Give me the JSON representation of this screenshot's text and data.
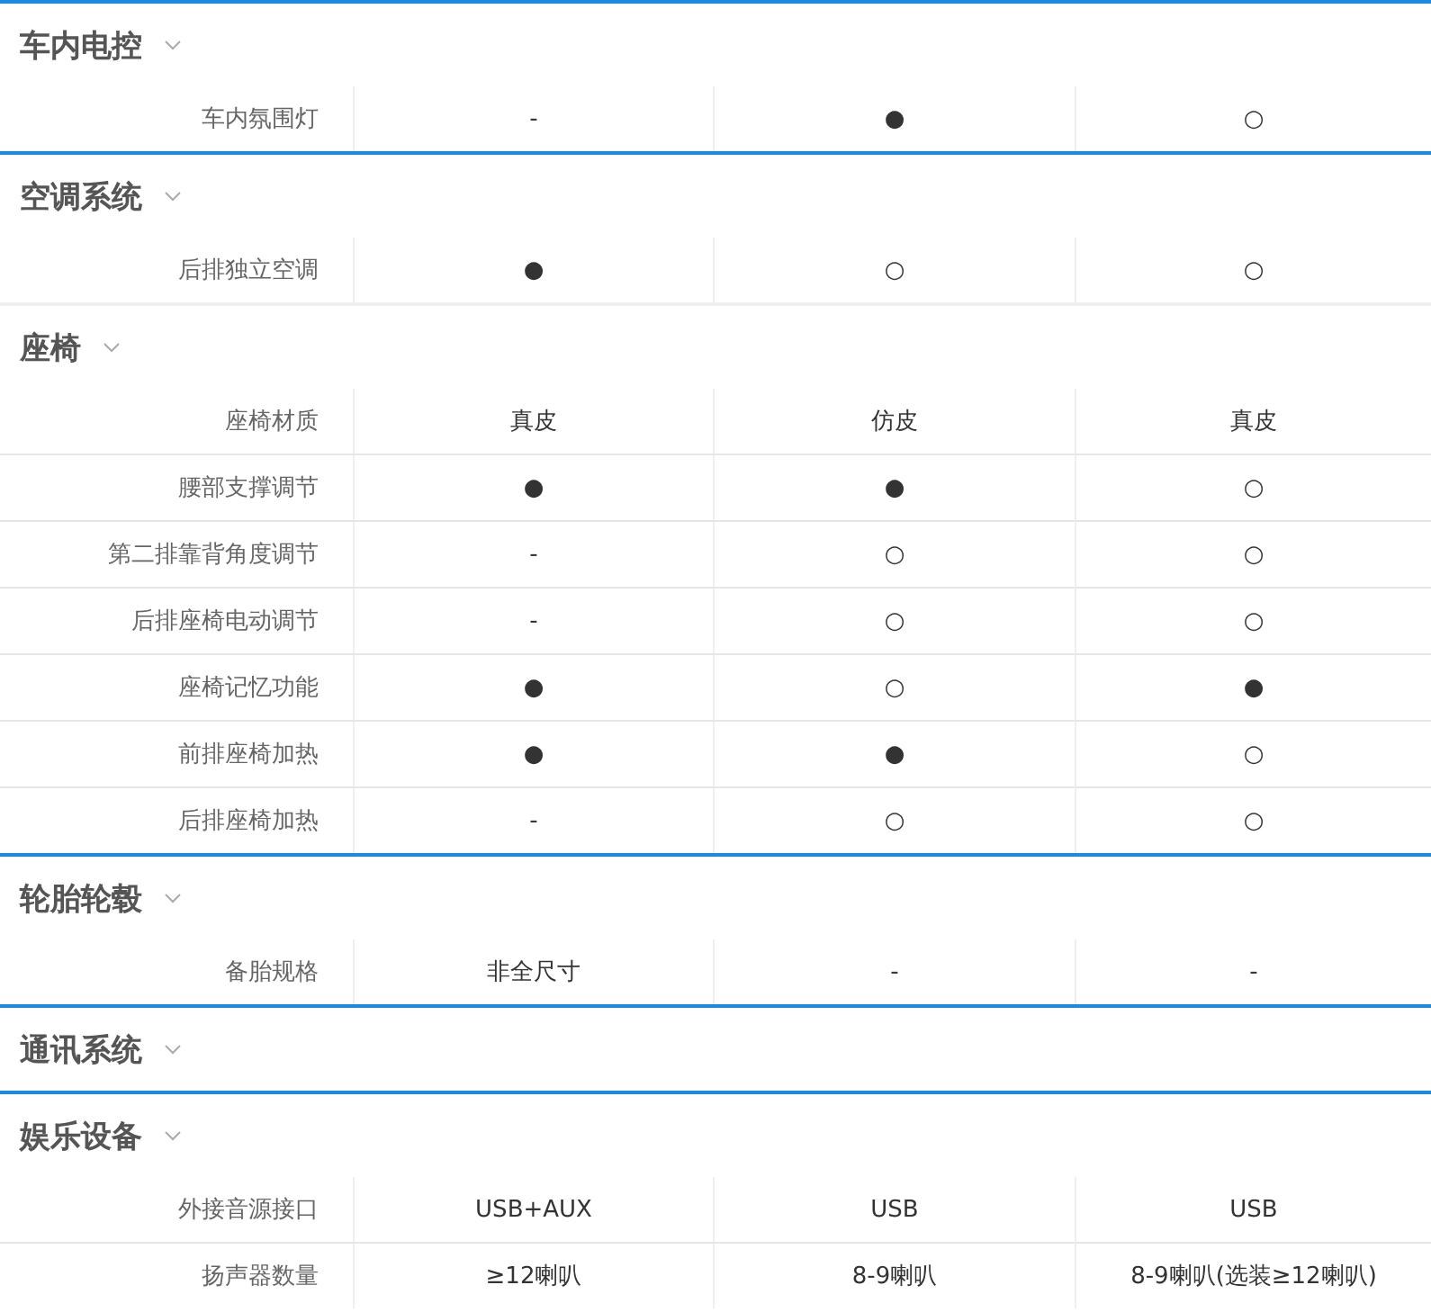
{
  "sections": [
    {
      "title": "车内电控",
      "accent_line": true,
      "rows": [
        {
          "label": "车内氛围灯",
          "values": [
            "-",
            "●",
            "○"
          ]
        }
      ]
    },
    {
      "title": "空调系统",
      "accent_line": true,
      "rows": [
        {
          "label": "后排独立空调",
          "values": [
            "●",
            "○",
            "○"
          ]
        }
      ]
    },
    {
      "title": "座椅",
      "accent_line": false,
      "rows": [
        {
          "label": "座椅材质",
          "values": [
            "真皮",
            "仿皮",
            "真皮"
          ]
        },
        {
          "label": "腰部支撑调节",
          "values": [
            "●",
            "●",
            "○"
          ]
        },
        {
          "label": "第二排靠背角度调节",
          "values": [
            "-",
            "○",
            "○"
          ]
        },
        {
          "label": "后排座椅电动调节",
          "values": [
            "-",
            "○",
            "○"
          ]
        },
        {
          "label": "座椅记忆功能",
          "values": [
            "●",
            "○",
            "●"
          ]
        },
        {
          "label": "前排座椅加热",
          "values": [
            "●",
            "●",
            "○"
          ]
        },
        {
          "label": "后排座椅加热",
          "values": [
            "-",
            "○",
            "○"
          ]
        }
      ]
    },
    {
      "title": "轮胎轮毂",
      "accent_line": true,
      "rows": [
        {
          "label": "备胎规格",
          "values": [
            "非全尺寸",
            "-",
            "-"
          ]
        }
      ]
    },
    {
      "title": "通讯系统",
      "accent_line": true
    },
    {
      "title": "娱乐设备",
      "accent_line": true,
      "rows": [
        {
          "label": "外接音源接口",
          "values": [
            "USB+AUX",
            "USB",
            "USB"
          ]
        },
        {
          "label": "扬声器数量",
          "values": [
            "≥12喇叭",
            "8-9喇叭",
            "8-9喇叭(选装≥12喇叭)"
          ]
        }
      ]
    }
  ]
}
